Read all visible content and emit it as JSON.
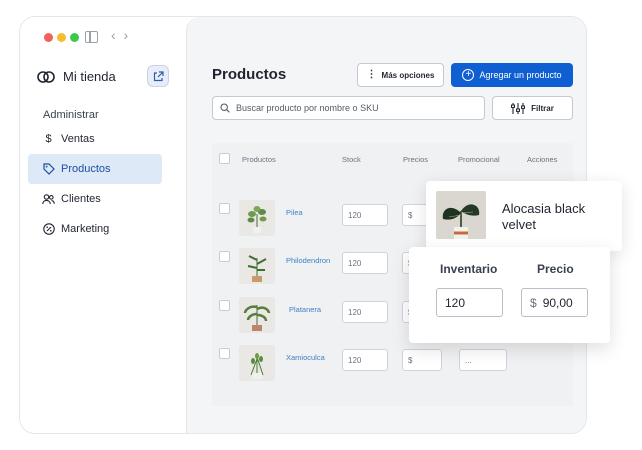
{
  "colors": {
    "accent": "#0f5fd2",
    "active_bg": "#dde9f7",
    "link": "#3b82c4",
    "traffic_red": "#f2605b",
    "traffic_yellow": "#f7bb2e",
    "traffic_green": "#3ec84a"
  },
  "sidebar": {
    "store_name": "Mi tienda",
    "section_label": "Administrar",
    "items": [
      {
        "label": "Ventas",
        "icon": "dollar-icon"
      },
      {
        "label": "Productos",
        "icon": "tag-icon",
        "active": true
      },
      {
        "label": "Clientes",
        "icon": "users-icon"
      },
      {
        "label": "Marketing",
        "icon": "percent-icon"
      }
    ]
  },
  "header": {
    "title": "Productos",
    "more_options": "Más opciones",
    "add_product": "Agregar un producto"
  },
  "search": {
    "placeholder": "Buscar producto por nombre o SKU"
  },
  "filter_label": "Filtrar",
  "table": {
    "columns": [
      "Productos",
      "Stock",
      "Precios",
      "Promocional",
      "Acciones"
    ],
    "rows": [
      {
        "name": "Pilea",
        "stock": "120",
        "price_prefix": "$"
      },
      {
        "name": "Philodendron",
        "stock": "120",
        "price_prefix": "$"
      },
      {
        "name": "Platanera",
        "stock": "120",
        "price_prefix": "$"
      },
      {
        "name": "Xamioculca",
        "stock": "120",
        "price_prefix": "$",
        "promo_value": "..."
      }
    ]
  },
  "popup": {
    "product_name": "Alocasia black velvet",
    "inventory_label": "Inventario",
    "inventory_value": "120",
    "price_label": "Precio",
    "price_prefix": "$",
    "price_value": "90,00"
  }
}
